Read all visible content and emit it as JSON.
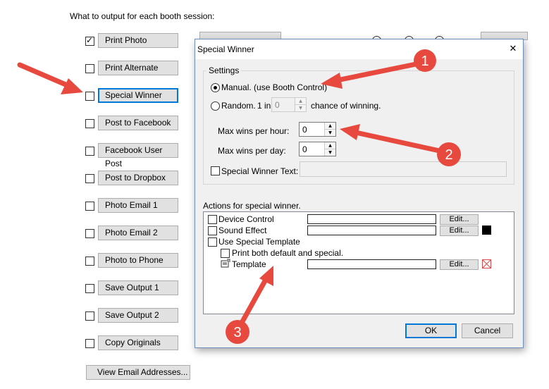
{
  "main": {
    "heading": "What to output for each booth session:",
    "outputs": [
      {
        "label": "Print Photo",
        "checked": true
      },
      {
        "label": "Print Alternate",
        "checked": false
      },
      {
        "label": "Special Winner",
        "checked": false,
        "focused": true
      },
      {
        "label": "Post to Facebook",
        "checked": false
      },
      {
        "label": "Facebook User Post",
        "checked": false
      },
      {
        "label": "Post to Dropbox",
        "checked": false
      },
      {
        "label": "Photo Email 1",
        "checked": false
      },
      {
        "label": "Photo Email 2",
        "checked": false
      },
      {
        "label": "Photo to Phone",
        "checked": false
      },
      {
        "label": "Save Output 1",
        "checked": false
      },
      {
        "label": "Save Output 2",
        "checked": false
      },
      {
        "label": "Copy Originals",
        "checked": false
      }
    ],
    "view_email_button": "View Email Addresses..."
  },
  "dialog": {
    "title": "Special Winner",
    "close_icon": "close-icon",
    "settings": {
      "group_label": "Settings",
      "manual_label": "Manual. (use Booth Control)",
      "random_label": "Random.",
      "one_in_label": "1 in",
      "one_in_value": "0",
      "chance_label": "chance of winning.",
      "max_hour_label": "Max wins per hour:",
      "max_hour_value": "0",
      "max_day_label": "Max wins per day:",
      "max_day_value": "0",
      "winner_text_label": "Special Winner Text:",
      "winner_text_value": ""
    },
    "actions": {
      "group_label": "Actions for special winner.",
      "items": {
        "device_control": "Device Control",
        "sound_effect": "Sound Effect",
        "use_template": "Use Special Template",
        "print_both": "Print both default and special.",
        "template": "Template"
      },
      "edit_label": "Edit..."
    },
    "ok_label": "OK",
    "cancel_label": "Cancel"
  },
  "annotations": {
    "callout_1": "1",
    "callout_2": "2",
    "callout_3": "3",
    "arrow_color": "#e8493f"
  }
}
